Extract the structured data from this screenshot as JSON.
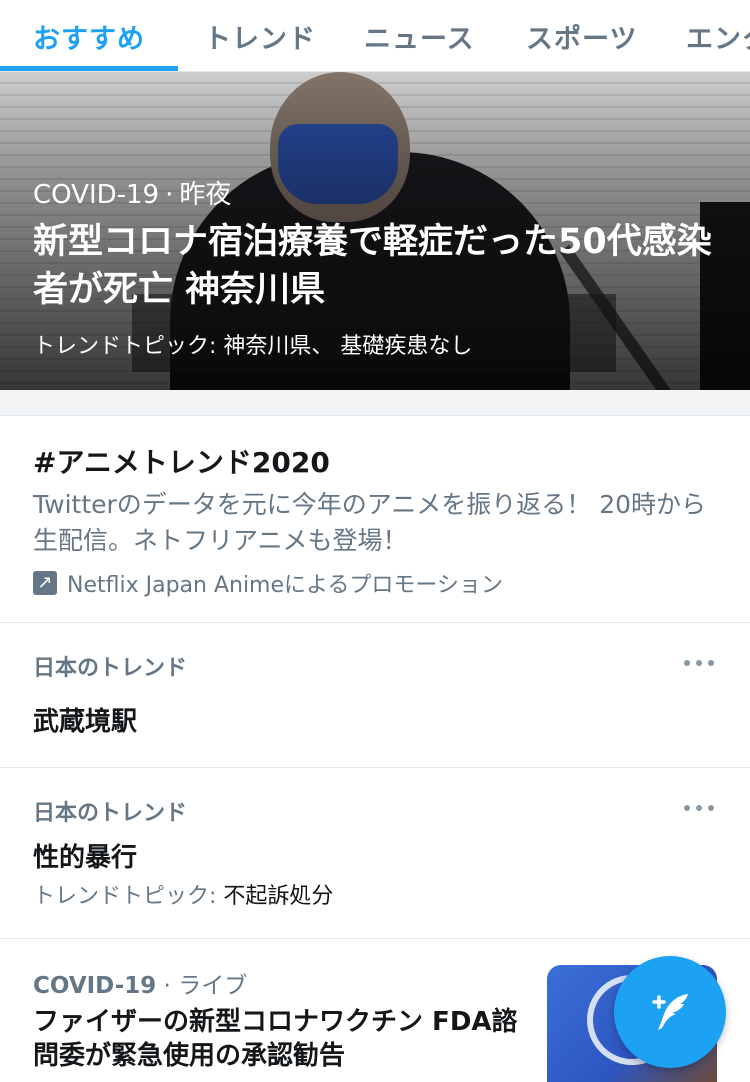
{
  "tabs": [
    {
      "label": "おすすめ",
      "active": true
    },
    {
      "label": "トレンド"
    },
    {
      "label": "ニュース"
    },
    {
      "label": "スポーツ"
    },
    {
      "label": "エンタ"
    }
  ],
  "hero": {
    "category": "COVID-19",
    "time": "昨夜",
    "title": "新型コロナ宿泊療養で軽症だった50代感染者が死亡 神奈川県",
    "topic_prefix": "トレンドトピック: ",
    "topics": "神奈川県、 基礎疾患なし"
  },
  "promo": {
    "title": "#アニメトレンド2020",
    "description": "Twitterのデータを元に今年のアニメを振り返る！ 20時から生配信。ネトフリアニメも登場！",
    "promoted_by": "Netflix Japan Animeによるプロモーション",
    "icon": "promoted-arrow-icon"
  },
  "trends": [
    {
      "label": "日本のトレンド",
      "name": "武蔵境駅"
    },
    {
      "label": "日本のトレンド",
      "name": "性的暴行",
      "topic_prefix": "トレンドトピック: ",
      "topic": "不起訴処分"
    }
  ],
  "bottom_item": {
    "category": "COVID-19",
    "time": "ライブ",
    "title": "ファイザーの新型コロナワクチン FDA諮問委が緊急使用の承認勧告"
  },
  "fab": {
    "icon": "compose-tweet-icon"
  },
  "colors": {
    "accent": "#1da1f2",
    "secondary_text": "#657786",
    "primary_text": "#14171a"
  }
}
